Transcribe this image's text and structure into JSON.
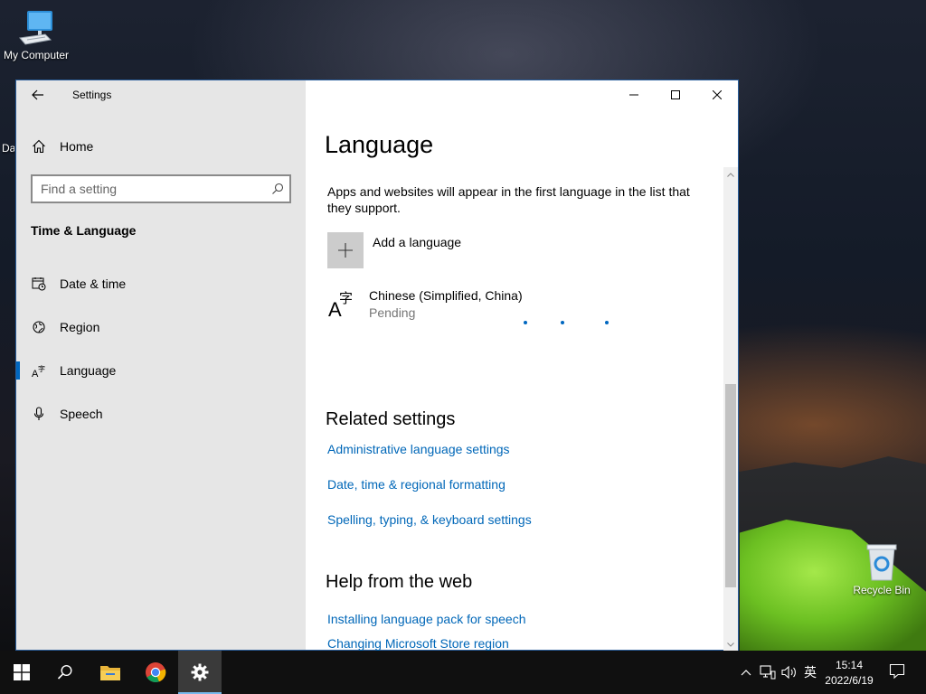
{
  "desktop": {
    "icons": [
      {
        "label": "My Computer"
      },
      {
        "label": "Recycle Bin"
      }
    ],
    "partial_label": "Da"
  },
  "window": {
    "title": "Settings",
    "sidebar": {
      "home": "Home",
      "search_placeholder": "Find a setting",
      "section": "Time & Language",
      "items": [
        {
          "label": "Date & time",
          "icon": "calendar-clock-icon"
        },
        {
          "label": "Region",
          "icon": "globe-icon"
        },
        {
          "label": "Language",
          "icon": "language-icon",
          "active": true
        },
        {
          "label": "Speech",
          "icon": "microphone-icon"
        }
      ]
    },
    "main": {
      "title": "Language",
      "description": "Apps and websites will appear in the first language in the list that they support.",
      "add_language": "Add a language",
      "languages": [
        {
          "name": "Chinese (Simplified, China)",
          "status": "Pending"
        }
      ],
      "related_heading": "Related settings",
      "related_links": [
        "Administrative language settings",
        "Date, time & regional formatting",
        "Spelling, typing, & keyboard settings"
      ],
      "help_heading": "Help from the web",
      "help_links": [
        "Installing language pack for speech",
        "Changing Microsoft Store region"
      ]
    }
  },
  "taskbar": {
    "ime_indicator": "英",
    "time": "15:14",
    "date": "2022/6/19"
  },
  "colors": {
    "accent": "#0067c0",
    "link": "#0067b8",
    "sidebar_bg": "#e6e6e6"
  }
}
